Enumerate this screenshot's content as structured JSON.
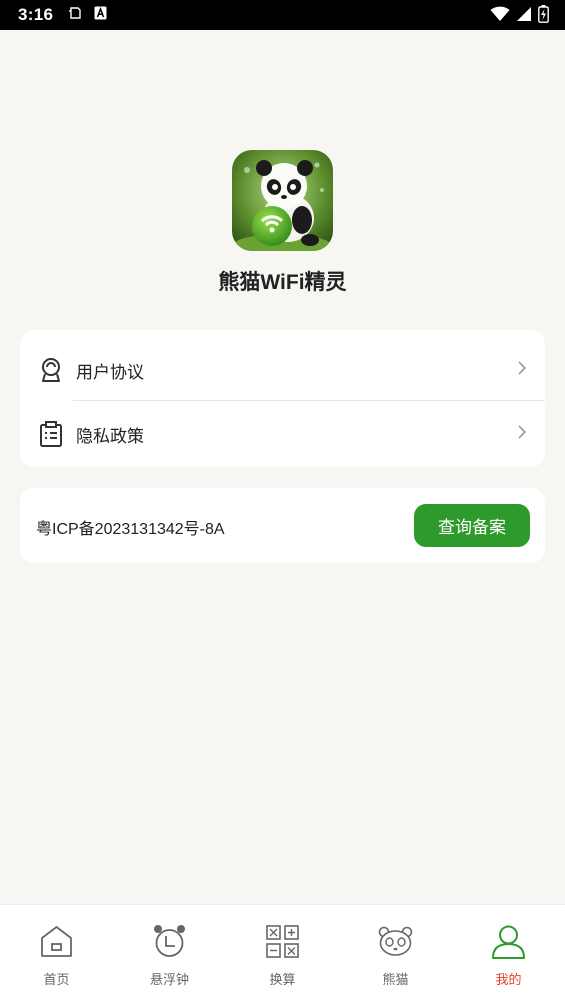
{
  "status_bar": {
    "time": "3:16",
    "left_icons": [
      "screenshot-icon",
      "keyboard-a-icon"
    ],
    "right_icons": [
      "wifi-icon",
      "signal-icon",
      "battery-charging-icon"
    ]
  },
  "app": {
    "name": "熊猫WiFi精灵",
    "icon": "panda-wifi-app-icon"
  },
  "menu": {
    "items": [
      {
        "label": "用户协议",
        "icon": "user-agreement-icon"
      },
      {
        "label": "隐私政策",
        "icon": "clipboard-icon"
      }
    ]
  },
  "icp": {
    "text": "粤ICP备2023131342号-8A",
    "button_label": "查询备案",
    "button_color": "#2f9a2c"
  },
  "bottom_nav": {
    "items": [
      {
        "label": "首页",
        "icon": "home-icon"
      },
      {
        "label": "悬浮钟",
        "icon": "alarm-clock-icon"
      },
      {
        "label": "换算",
        "icon": "calculator-icon"
      },
      {
        "label": "熊猫",
        "icon": "panda-icon"
      },
      {
        "label": "我的",
        "icon": "user-icon",
        "active": true
      }
    ],
    "active_color": "#e8412c",
    "active_icon_color": "#2f9a2c"
  }
}
